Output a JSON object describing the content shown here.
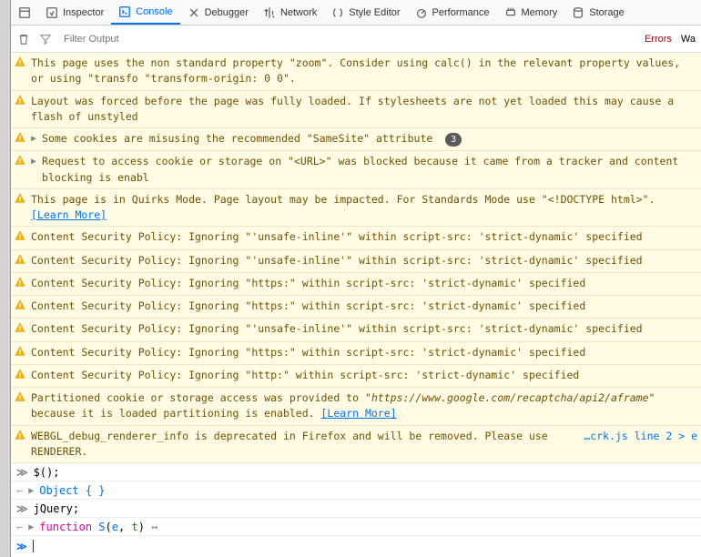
{
  "tabs": {
    "inspector": "Inspector",
    "console": "Console",
    "debugger": "Debugger",
    "network": "Network",
    "style": "Style Editor",
    "performance": "Performance",
    "memory": "Memory",
    "storage": "Storage"
  },
  "filter": {
    "placeholder": "Filter Output"
  },
  "btns": {
    "errors": "Errors",
    "warnings": "Wa"
  },
  "badge3": "3",
  "msg": {
    "zoom": "This page uses the non standard property \"zoom\". Consider using calc() in the relevant property values, or using \"transfo \"transform-origin: 0 0\".",
    "layout": "Layout was forced before the page was fully loaded. If stylesheets are not yet loaded this may cause a flash of unstyled ",
    "samesite": "Some cookies are misusing the recommended \"SameSite\" attribute",
    "tracker": "Request to access cookie or storage on \"<URL>\" was blocked because it came from a tracker and content blocking is enabl",
    "quirks1": "This page is in Quirks Mode. Page layout may be impacted. For Standards Mode use \"<!DOCTYPE html>\". ",
    "learnmore": "[Learn More]",
    "csp_inline": "Content Security Policy: Ignoring \"'unsafe-inline'\" within script-src: 'strict-dynamic' specified",
    "csp_https": "Content Security Policy: Ignoring \"https:\" within script-src: 'strict-dynamic' specified",
    "csp_http": "Content Security Policy: Ignoring \"http:\" within script-src: 'strict-dynamic' specified",
    "partitioned1": "Partitioned cookie or storage access was provided to \"",
    "partitioned_url": "https://www.google.com/recaptcha/api2/aframe",
    "partitioned2": "\" because it is loaded  partitioning is enabled. ",
    "webgl": "WEBGL_debug_renderer_info is deprecated in Firefox and will be removed. Please use RENDERER.",
    "webgl_src": "…crk.js line 2 > e"
  },
  "repl": {
    "in1": "$();",
    "out1a": "Object {  }",
    "in2": "jQuery;",
    "out2_kw": "function",
    "out2_name": "S",
    "out2_p1": "e",
    "out2_p2": "t"
  }
}
